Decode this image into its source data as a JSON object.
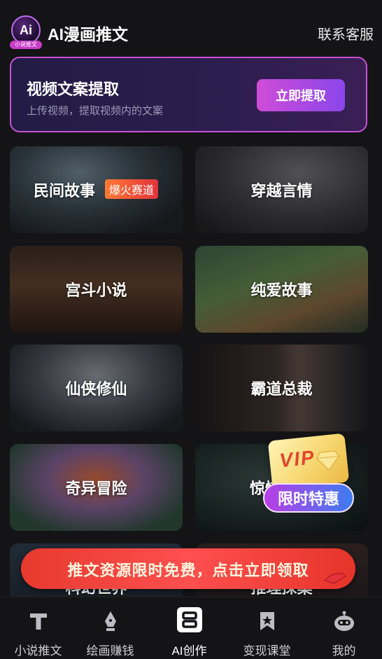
{
  "header": {
    "logo_text": "Ai",
    "logo_tag": "小说推文",
    "title": "AI漫画推文",
    "contact_label": "联系客服"
  },
  "banner": {
    "title": "视频文案提取",
    "subtitle": "上传视频，提取视频内的文案",
    "button_label": "立即提取"
  },
  "categories": [
    {
      "label": "民间故事",
      "badge": "爆火赛道"
    },
    {
      "label": "穿越言情"
    },
    {
      "label": "宫斗小说"
    },
    {
      "label": "纯爱故事"
    },
    {
      "label": "仙侠修仙"
    },
    {
      "label": "霸道总裁"
    },
    {
      "label": "奇异冒险"
    },
    {
      "label": "惊悚"
    },
    {
      "label": "科幻世界"
    },
    {
      "label": "推理探案"
    }
  ],
  "vip": {
    "card_text": "VIP",
    "pill_text": "限时特惠"
  },
  "promo": {
    "text": "推文资源限时免费，点击立即领取"
  },
  "tabs": [
    {
      "label": "小说推文",
      "icon": "text-t-icon"
    },
    {
      "label": "绘画赚钱",
      "icon": "pen-nib-icon"
    },
    {
      "label": "AI创作",
      "icon": "ai-create-icon",
      "active": true
    },
    {
      "label": "变现课堂",
      "icon": "bookmark-star-icon"
    },
    {
      "label": "我的",
      "icon": "robot-profile-icon"
    }
  ],
  "colors": {
    "accent": "#c850d8",
    "button_gradient_start": "#cf4cd8",
    "button_gradient_end": "#8a46ea",
    "badge": "#e2323a",
    "promo": "#e63a2e",
    "background": "#141416"
  }
}
